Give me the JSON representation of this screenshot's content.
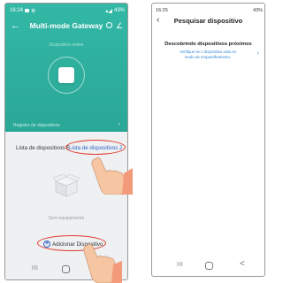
{
  "left_phone": {
    "status": {
      "time": "16:24",
      "battery": "43%"
    },
    "title": "Multi-mode Gateway",
    "online_status": "Dispositivo online",
    "records_label": "Registro de dispositivos",
    "tabs": [
      {
        "label": "Lista de dispositivos B"
      },
      {
        "label": "Lista de dispositivos Zi..."
      }
    ],
    "empty_label": "Sem equipamento",
    "add_button_label": "Adicionar Dispositivo",
    "icons": {
      "back": "back-arrow-icon",
      "settings": "circle-icon",
      "edit": "pencil-icon"
    },
    "colors": {
      "header": "#2fb3a2",
      "highlight": "#e03a2e",
      "link": "#2f62c9"
    }
  },
  "right_phone": {
    "status": {
      "time": "16:25",
      "battery": "43%"
    },
    "title": "Pesquisar dispositivo",
    "discover_title": "Descobrindo dispositivos próximos",
    "discover_subtitle": "Verifique se o dispositivo está no modo de emparelhamento.",
    "colors": {
      "link": "#2f88d8"
    }
  },
  "nav_glyphs": {
    "recents": "III",
    "back": "<"
  }
}
